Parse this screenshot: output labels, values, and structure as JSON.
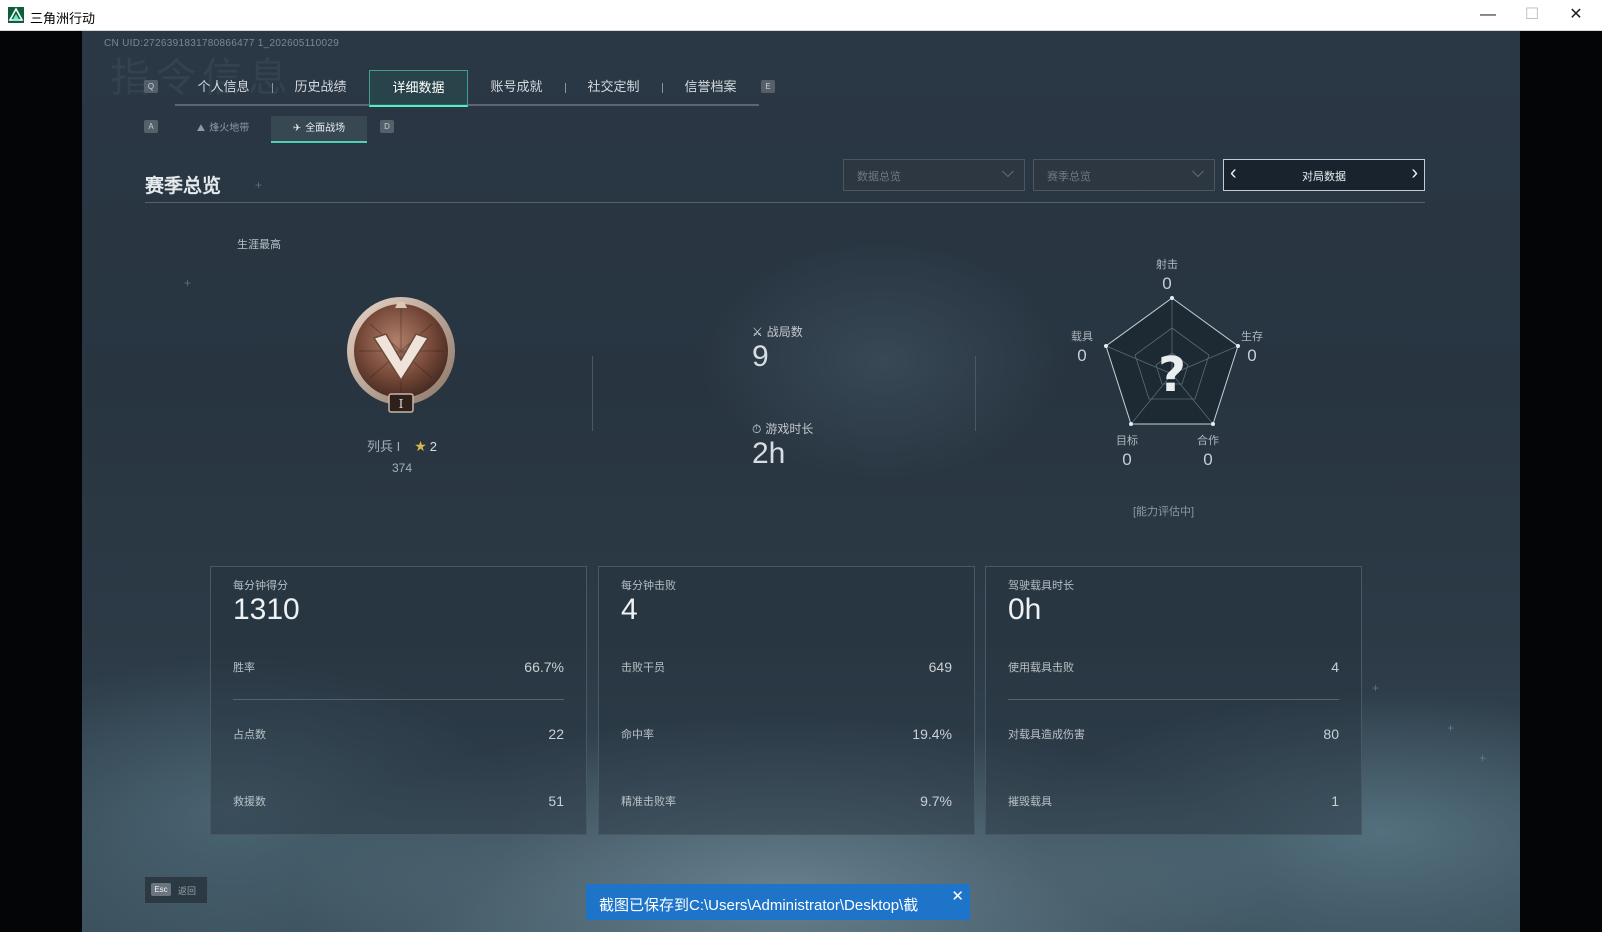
{
  "window": {
    "title": "三角洲行动",
    "minimize": "—",
    "maximize": "☐",
    "close": "✕"
  },
  "header": {
    "uid": "CN UID:2726391831780866477 1_202605110029",
    "watermark": "指令信息"
  },
  "tabs": {
    "prev_key": "Q",
    "next_key": "E",
    "items": [
      {
        "label": "个人信息"
      },
      {
        "label": "历史战绩"
      },
      {
        "label": "详细数据",
        "active": true
      },
      {
        "label": "账号成就"
      },
      {
        "label": "社交定制"
      },
      {
        "label": "信誉档案"
      }
    ]
  },
  "subtabs": {
    "prev_key": "A",
    "next_key": "D",
    "items": [
      {
        "label": "烽火地带",
        "icon": "outpost-icon"
      },
      {
        "label": "全面战场",
        "icon": "battlefield-icon",
        "active": true
      }
    ]
  },
  "section": {
    "title": "赛季总览"
  },
  "filters": {
    "data_select": "数据总览",
    "season_select": "赛季总览",
    "pager_label": "对局数据"
  },
  "career": {
    "label": "生涯最高",
    "rank_name": "列兵 I",
    "rank_numeral": "I",
    "stars": "2",
    "points": "374"
  },
  "summary": {
    "matches_label": "战局数",
    "matches_value": "9",
    "playtime_label": "游戏时长",
    "playtime_value": "2h"
  },
  "radar": {
    "axes": [
      {
        "label": "射击",
        "value": "0"
      },
      {
        "label": "生存",
        "value": "0"
      },
      {
        "label": "合作",
        "value": "0"
      },
      {
        "label": "目标",
        "value": "0"
      },
      {
        "label": "载具",
        "value": "0"
      }
    ],
    "placeholder": "?",
    "status": "[能力评估中]"
  },
  "cards": [
    {
      "caption": "每分钟得分",
      "value": "1310",
      "rows": [
        {
          "k": "胜率",
          "v": "66.7%"
        },
        {
          "k": "占点数",
          "v": "22"
        },
        {
          "k": "救援数",
          "v": "51"
        }
      ]
    },
    {
      "caption": "每分钟击败",
      "value": "4",
      "rows": [
        {
          "k": "击败干员",
          "v": "649"
        },
        {
          "k": "命中率",
          "v": "19.4%"
        },
        {
          "k": "精准击败率",
          "v": "9.7%"
        }
      ]
    },
    {
      "caption": "驾驶载具时长",
      "value": "0h",
      "rows": [
        {
          "k": "使用载具击败",
          "v": "4"
        },
        {
          "k": "对载具造成伤害",
          "v": "80"
        },
        {
          "k": "摧毁载具",
          "v": "1"
        }
      ]
    }
  ],
  "footer": {
    "esc_key": "Esc",
    "esc_label": "返回"
  },
  "toast": {
    "message": "截图已保存到C:\\Users\\Administrator\\Desktop\\截",
    "close": "✕"
  },
  "colors": {
    "accent": "#4ff0c5",
    "toast_bg": "#1e74c8",
    "medal_bronze": "#8a5a48"
  }
}
